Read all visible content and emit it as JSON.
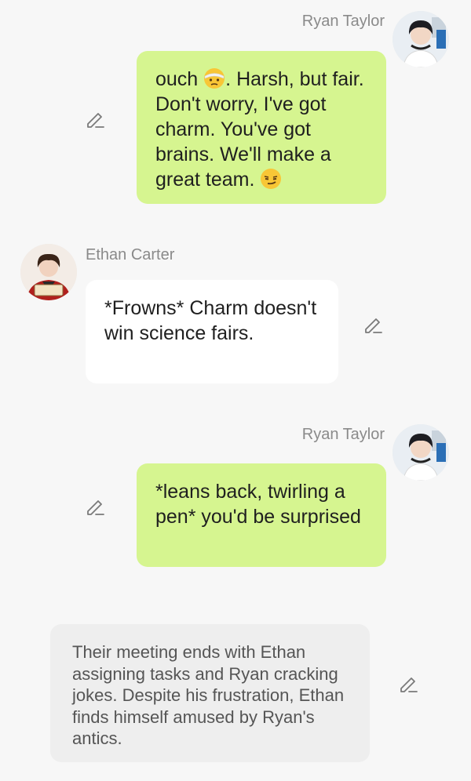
{
  "messages": [
    {
      "sender": "Ryan Taylor",
      "text_before": "ouch ",
      "emoji1": "face-with-head-bandage",
      "text_mid": ". Harsh, but fair. Don't worry, I've got charm. You've got brains. We'll make a great team. ",
      "emoji2": "smirking-face"
    },
    {
      "sender": "Ethan Carter",
      "text": "*Frowns* Charm doesn't win science fairs."
    },
    {
      "sender": "Ryan Taylor",
      "text": "*leans back, twirling a pen* you'd be surprised"
    },
    {
      "text": "Their meeting ends with Ethan assigning tasks and Ryan cracking jokes. Despite his frustration, Ethan finds himself amused by Ryan's antics."
    }
  ],
  "icons": {
    "edit": "pencil-icon"
  },
  "colors": {
    "background": "#f7f7f7",
    "user_bubble": "#d6f590",
    "char_bubble": "#ffffff",
    "narration_bubble": "#eeeeee",
    "name_text": "#8a8a8a"
  }
}
